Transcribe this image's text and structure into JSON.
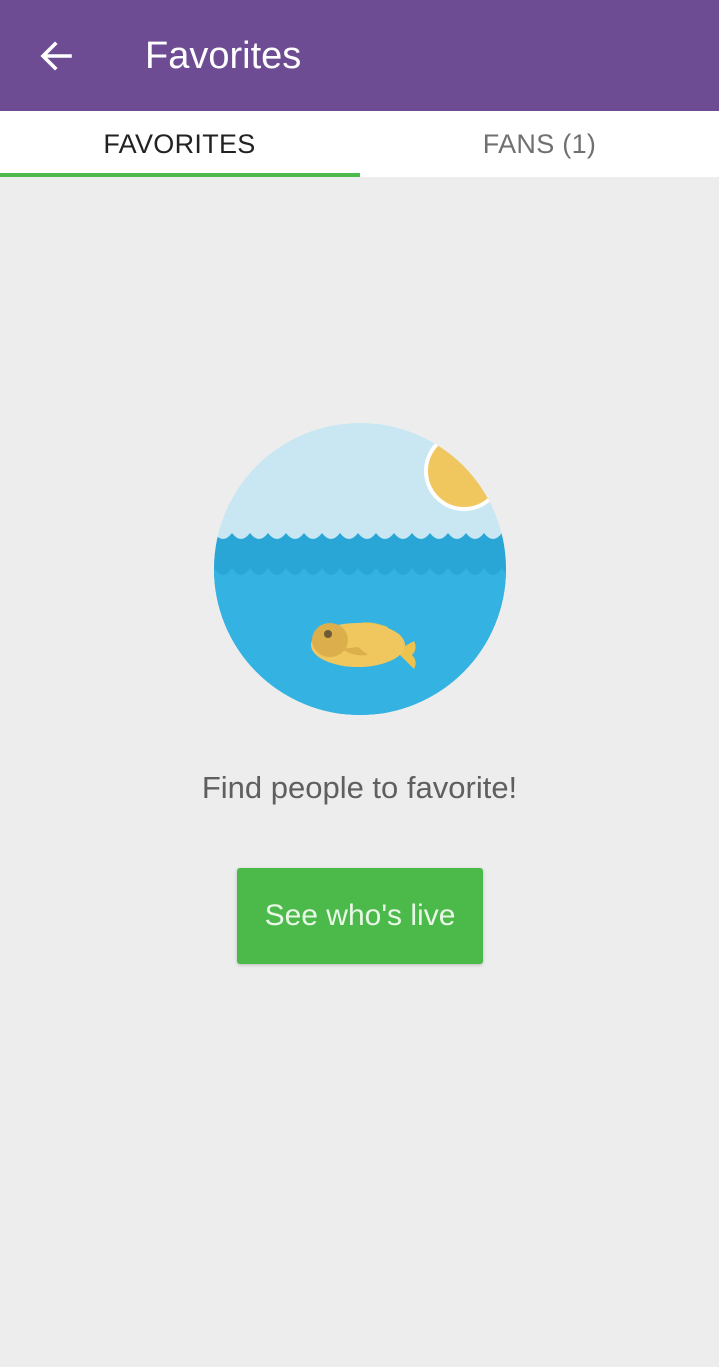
{
  "colors": {
    "app_bar": "#6e4c93",
    "accent": "#4cba4b",
    "background": "#ededed"
  },
  "header": {
    "back_icon": "arrow-back-icon",
    "title": "Favorites"
  },
  "tabs": [
    {
      "label": "FAVORITES",
      "selected": true
    },
    {
      "label": "FANS (1)",
      "selected": false
    }
  ],
  "empty_state": {
    "illustration": "fish-in-ocean-illustration",
    "message": "Find people to favorite!",
    "button_label": "See who's live"
  }
}
